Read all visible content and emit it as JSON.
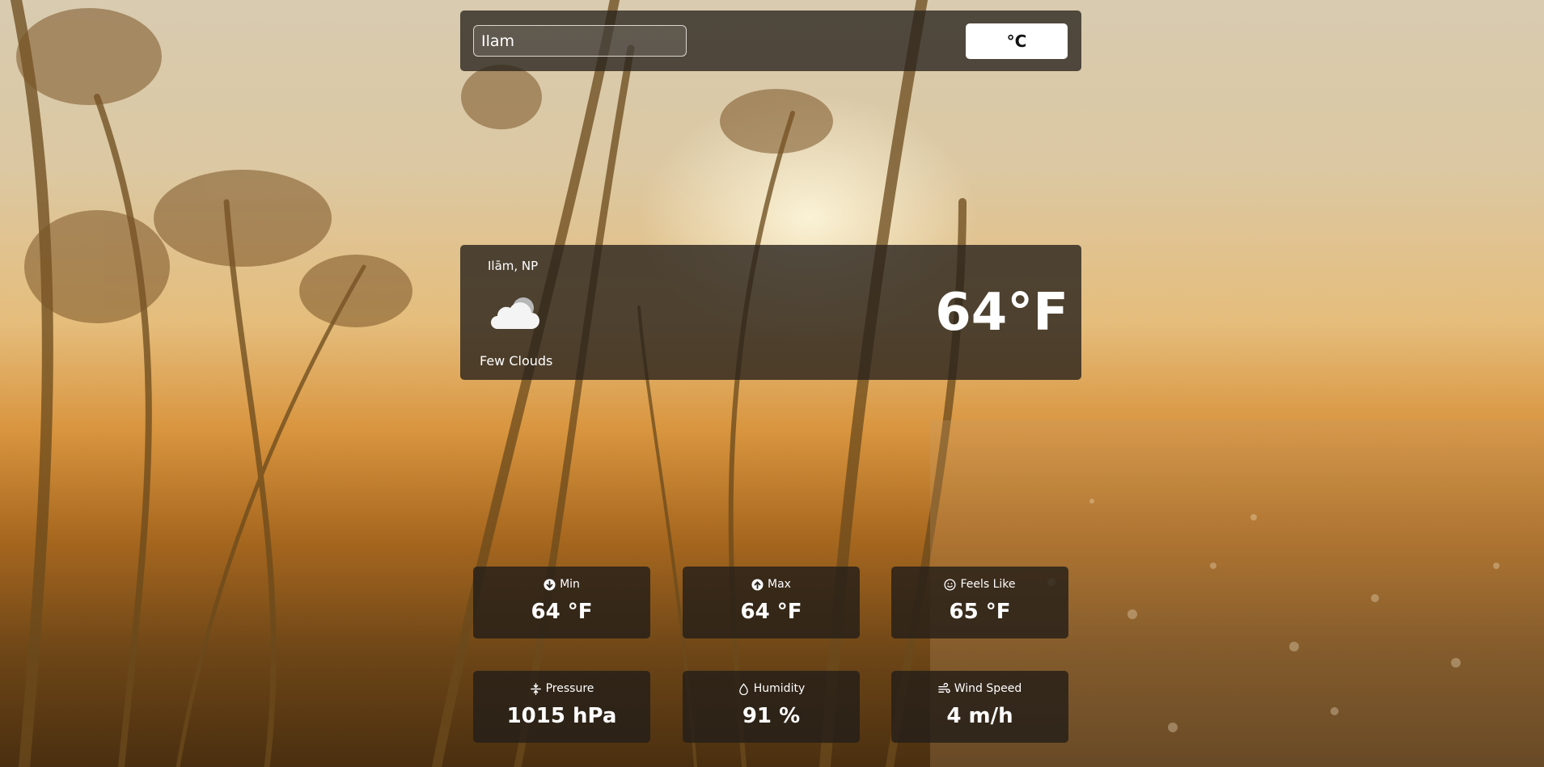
{
  "search": {
    "value": "Ilam"
  },
  "unit_toggle": {
    "label": "°C"
  },
  "current": {
    "location": "Ilām, NP",
    "condition": "Few Clouds",
    "temperature": "64°F",
    "icon": "few-clouds-icon"
  },
  "stats": [
    {
      "label": "Min",
      "value": "64 °F",
      "icon": "arrow-down-circle-icon"
    },
    {
      "label": "Max",
      "value": "64 °F",
      "icon": "arrow-up-circle-icon"
    },
    {
      "label": "Feels Like",
      "value": "65 °F",
      "icon": "smile-icon"
    },
    {
      "label": "Pressure",
      "value": "1015 hPa",
      "icon": "compress-icon"
    },
    {
      "label": "Humidity",
      "value": "91 %",
      "icon": "droplet-icon"
    },
    {
      "label": "Wind Speed",
      "value": "4 m/h",
      "icon": "wind-icon"
    }
  ],
  "colors": {
    "panel": "#28221c",
    "button_bg": "#ffffff",
    "text": "#ffffff"
  }
}
